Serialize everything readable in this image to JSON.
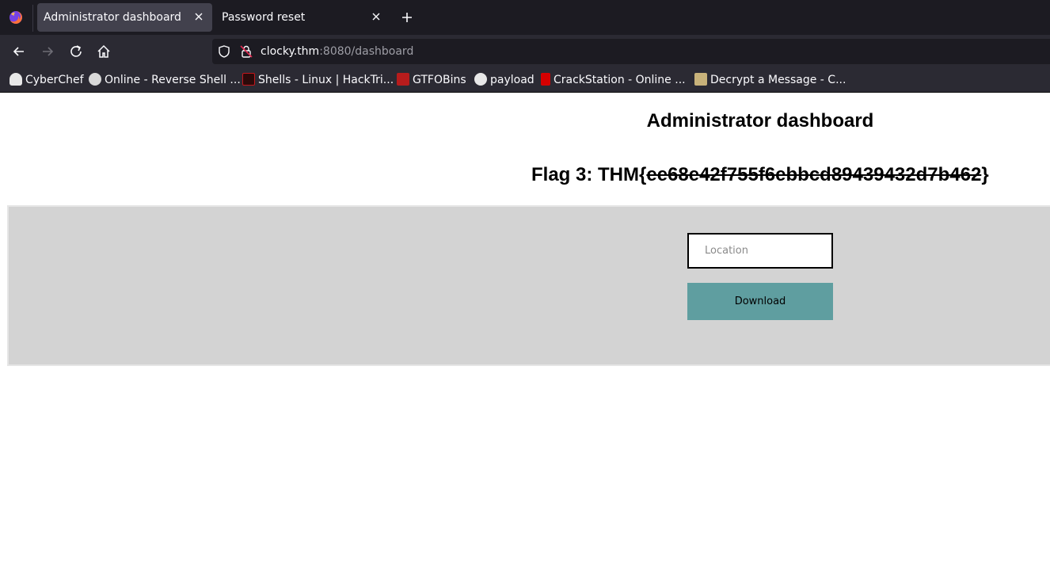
{
  "browser": {
    "tabs": [
      {
        "title": "Administrator dashboard",
        "active": true
      },
      {
        "title": "Password reset",
        "active": false
      }
    ],
    "url": {
      "host": "clocky.thm",
      "rest": ":8080/dashboard"
    },
    "bookmarks": [
      {
        "label": "CyberChef",
        "icon": "chef-hat-icon",
        "color": "#e8e8e8"
      },
      {
        "label": "Online - Reverse Shell ...",
        "icon": "skull-icon",
        "color": "#d9d9d9"
      },
      {
        "label": "Shells - Linux | HackTri...",
        "icon": "hacktricks-icon",
        "color": "#c4161c"
      },
      {
        "label": "GTFOBins",
        "icon": "gtfobins-icon",
        "color": "#b71c1c"
      },
      {
        "label": "payload",
        "icon": "github-icon",
        "color": "#e8e8e8"
      },
      {
        "label": "CrackStation - Online ...",
        "icon": "crackstation-icon",
        "color": "#d50000"
      },
      {
        "label": "Decrypt a Message - C...",
        "icon": "decrypt-icon",
        "color": "#c8b27a"
      }
    ]
  },
  "page": {
    "title": "Administrator dashboard",
    "flag_prefix": "Flag 3: THM{",
    "flag_value": "ee68e42f755f6ebbcd89439432d7b462",
    "flag_suffix": "}",
    "location_placeholder": "Location",
    "download_label": "Download"
  },
  "colors": {
    "panel": "#d3d3d3",
    "button": "#5f9ea0"
  }
}
